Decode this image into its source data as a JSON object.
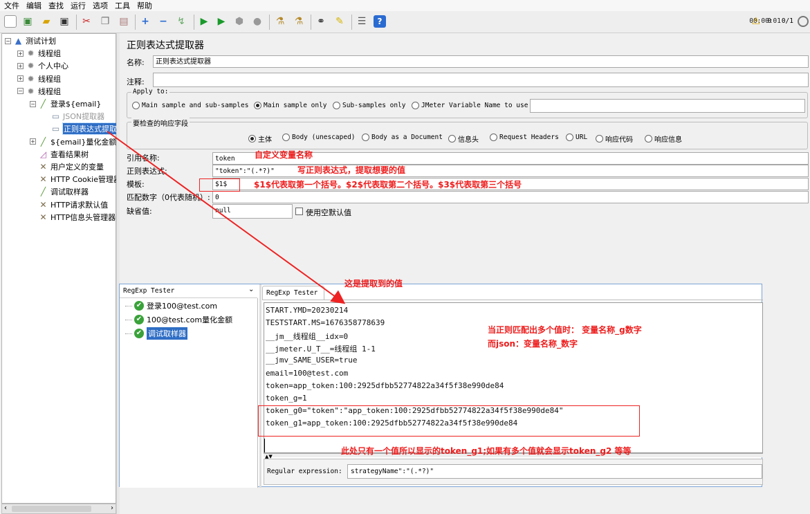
{
  "menu": [
    "文件",
    "编辑",
    "查找",
    "运行",
    "选项",
    "工具",
    "帮助"
  ],
  "status": {
    "timer": "00:00:01",
    "warning_count": "0",
    "threads": "0/1"
  },
  "toolbar_icons": [
    "new-icon",
    "templates-icon",
    "open-icon",
    "save-icon",
    "cut-icon",
    "copy-icon",
    "paste-icon",
    "expand-icon",
    "collapse-icon",
    "toggle-icon",
    "start-icon",
    "start-no-pause-icon",
    "stop-icon",
    "shutdown-icon",
    "clear-icon",
    "clear-all-icon",
    "search-icon",
    "reset-search-icon",
    "function-helper-icon",
    "help-icon"
  ],
  "tree": [
    {
      "label": "测试计划",
      "indent": 0,
      "exp": "⊟",
      "icon": "test-plan-icon"
    },
    {
      "label": "线程组",
      "indent": 1,
      "exp": "⊞",
      "icon": "thread-group-icon"
    },
    {
      "label": "个人中心",
      "indent": 1,
      "exp": "⊞",
      "icon": "thread-group-icon"
    },
    {
      "label": "线程组",
      "indent": 1,
      "exp": "⊞",
      "icon": "thread-group-icon"
    },
    {
      "label": "线程组",
      "indent": 1,
      "exp": "⊟",
      "icon": "thread-group-icon"
    },
    {
      "label": "登录${email}",
      "indent": 2,
      "exp": "⊟",
      "icon": "sampler-icon"
    },
    {
      "label": "JSON提取器",
      "indent": 3,
      "exp": "",
      "icon": "extractor-icon",
      "disabled": true
    },
    {
      "label": "正则表达式提取",
      "indent": 3,
      "exp": "",
      "icon": "extractor-icon",
      "selected": true
    },
    {
      "label": "${email}量化金额",
      "indent": 2,
      "exp": "⊞",
      "icon": "sampler-icon"
    },
    {
      "label": "查看结果树",
      "indent": 2,
      "exp": "",
      "icon": "listener-icon"
    },
    {
      "label": "用户定义的变量",
      "indent": 2,
      "exp": "",
      "icon": "config-icon"
    },
    {
      "label": "HTTP Cookie管理器",
      "indent": 2,
      "exp": "",
      "icon": "config-icon"
    },
    {
      "label": "调试取样器",
      "indent": 2,
      "exp": "",
      "icon": "sampler-icon"
    },
    {
      "label": "HTTP请求默认值",
      "indent": 2,
      "exp": "",
      "icon": "config-icon"
    },
    {
      "label": "HTTP信息头管理器",
      "indent": 2,
      "exp": "",
      "icon": "config-icon"
    }
  ],
  "panel": {
    "title": "正则表达式提取器",
    "name_label": "名称:",
    "name_value": "正则表达式提取器",
    "comment_label": "注释:",
    "comment_value": "",
    "apply_to_legend": "Apply to:",
    "apply_options": [
      "Main sample and sub-samples",
      "Main sample only",
      "Sub-samples only",
      "JMeter Variable Name to use"
    ],
    "apply_selected": 1,
    "field_legend": "要检查的响应字段",
    "field_options": [
      "主体",
      "Body (unescaped)",
      "Body as a Document",
      "信息头",
      "Request Headers",
      "URL",
      "响应代码",
      "响应信息"
    ],
    "field_selected": 0,
    "ref_name_label": "引用名称:",
    "ref_name_value": "token",
    "regex_label": "正则表达式:",
    "regex_value": "\"token\":\"(.*?)\"",
    "template_label": "模板:",
    "template_value": "$1$",
    "match_label": "匹配数字（0代表随机）:",
    "match_value": "0",
    "default_label": "缺省值:",
    "default_value": "null",
    "use_empty_label": "使用空默认值"
  },
  "annotations": {
    "a1": "自定义变量名称",
    "a2": "写正则表达式，提取想要的值",
    "a3": "$1$代表取第一个括号。$2$代表取第二个括号。$3$代表取第三个括号",
    "a4": "这是提取到的值",
    "a5_line1": "当正则匹配出多个值时： 变量名称_g数字",
    "a5_line2": "而json：变量名称_数字",
    "a6": "此处只有一个值所以显示的token_g1;如果有多个值就会显示token_g2 等等"
  },
  "tester": {
    "dropdown_label": "RegExp Tester",
    "tab_label": "RegExp Tester",
    "results": [
      {
        "label": "登录100@test.com"
      },
      {
        "label": "100@test.com量化金额"
      },
      {
        "label": "调试取样器",
        "selected": true
      }
    ],
    "output_lines": [
      "START.YMD=20230214",
      "TESTSTART.MS=1676358778639",
      "__jm__线程组__idx=0",
      "__jmeter.U_T__=线程组 1-1",
      "__jmv_SAME_USER=true",
      "email=100@test.com",
      "token=app_token:100:2925dfbb52774822a34f5f38e990de84",
      "token_g=1",
      "token_g0=\"token\":\"app_token:100:2925dfbb52774822a34f5f38e990de84\"",
      "token_g1=app_token:100:2925dfbb52774822a34f5f38e990de84"
    ],
    "regex_label": "Regular expression:",
    "regex_value": "strategyName\":\"(.*?)\""
  }
}
